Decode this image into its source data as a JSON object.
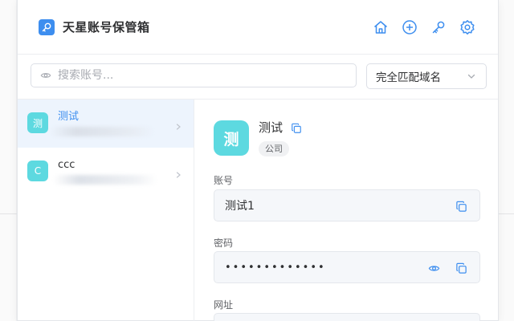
{
  "app": {
    "title": "天星账号保管箱"
  },
  "header": {
    "icons": [
      "home-icon",
      "plus-circle-icon",
      "key-icon",
      "gear-icon"
    ]
  },
  "search": {
    "placeholder": "搜索账号...",
    "value": ""
  },
  "match_select": {
    "value": "完全匹配域名"
  },
  "accounts": [
    {
      "avatar": "测",
      "name": "测试",
      "active": true
    },
    {
      "avatar": "C",
      "name": "ccc",
      "active": false
    }
  ],
  "detail": {
    "avatar": "测",
    "name": "测试",
    "tag": "公司",
    "fields": {
      "account_label": "账号",
      "account_value": "测试1",
      "password_label": "密码",
      "password_value": "•••••••••••••",
      "url_label": "网址"
    }
  },
  "colors": {
    "accent": "#3d8eef",
    "avatar": "#5dd9e0",
    "active_bg": "#edf4fd",
    "field_bg": "#f5f7fa"
  }
}
